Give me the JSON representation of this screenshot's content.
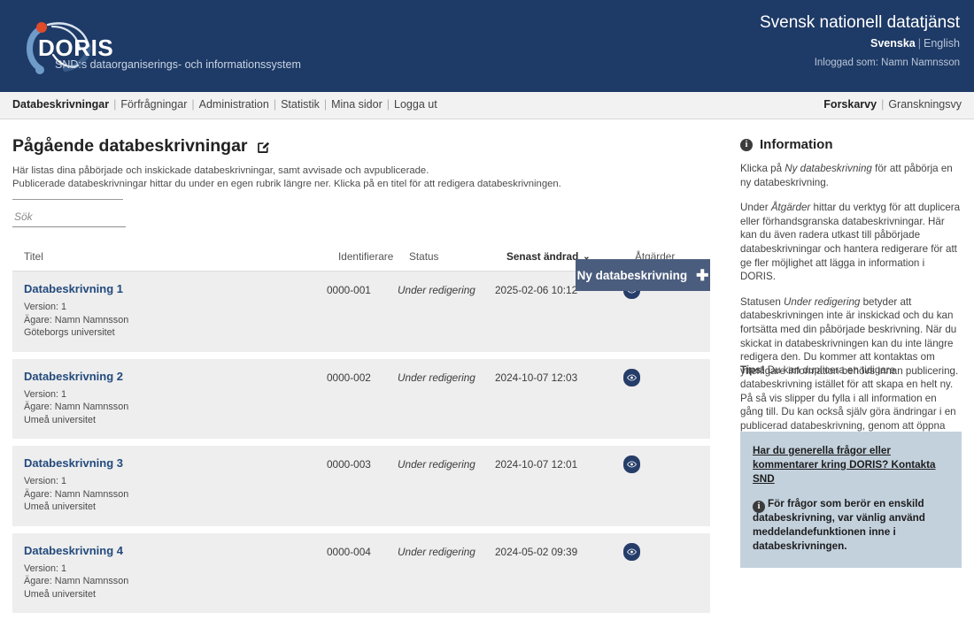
{
  "header": {
    "logo_word": "DORIS",
    "logo_subtitle": "SND:s dataorganiserings- och informationssystem",
    "brand_title": "Svensk nationell datatjänst",
    "lang_active": "Svenska",
    "lang_sep": "|",
    "lang_other": "English",
    "logged_in": "Inloggad som: Namn Namnsson"
  },
  "nav": {
    "left_items": [
      {
        "label": "Databeskrivningar",
        "current": true
      },
      {
        "label": "Förfrågningar",
        "current": false
      },
      {
        "label": "Administration",
        "current": false
      },
      {
        "label": "Statistik",
        "current": false
      },
      {
        "label": "Mina sidor",
        "current": false
      },
      {
        "label": "Logga ut",
        "current": false
      }
    ],
    "right_items": [
      {
        "label": "Forskarvy",
        "current": true
      },
      {
        "label": "Granskningsvy",
        "current": false
      }
    ],
    "separator": "|"
  },
  "main": {
    "page_title": "Pågående databeskrivningar",
    "intro_line1": "Här listas dina påbörjade och inskickade databeskrivningar, samt avvisade och avpublicerade.",
    "intro_line2": "Publicerade databeskrivningar hittar du under en egen rubrik längre ner. Klicka på en titel för att redigera databeskrivningen.",
    "search_placeholder": "Sök",
    "search_value": "",
    "new_button_label": "Ny databeskrivning",
    "new_button_icon": "plus-icon",
    "edit_icon": "edit-pencil-icon"
  },
  "table": {
    "columns": {
      "titel": "Titel",
      "identifierare": "Identifierare",
      "status": "Status",
      "senast_andrad": "Senast ändrad",
      "atgarder": "Åtgärder"
    },
    "sort_indicator": "⌄",
    "rows": [
      {
        "title": "Databeskrivning 1",
        "version": "Version: 1",
        "owner": "Ägare: Namn Namnsson",
        "organisation": "Göteborgs universitet",
        "identifier": "0000-001",
        "status": "Under redigering",
        "modified": "2025-02-06 10:12",
        "action_icon": "eye-icon"
      },
      {
        "title": "Databeskrivning 2",
        "version": "Version: 1",
        "owner": "Ägare: Namn Namnsson",
        "organisation": "Umeå universitet",
        "identifier": "0000-002",
        "status": "Under redigering",
        "modified": "2024-10-07 12:03",
        "action_icon": "eye-icon"
      },
      {
        "title": "Databeskrivning 3",
        "version": "Version: 1",
        "owner": "Ägare: Namn Namnsson",
        "organisation": "Umeå universitet",
        "identifier": "0000-003",
        "status": "Under redigering",
        "modified": "2024-10-07 12:01",
        "action_icon": "eye-icon"
      },
      {
        "title": "Databeskrivning 4",
        "version": "Version: 1",
        "owner": "Ägare: Namn Namnsson",
        "organisation": "Umeå universitet",
        "identifier": "0000-004",
        "status": "Under redigering",
        "modified": "2024-05-02 09:39",
        "action_icon": "eye-icon"
      }
    ]
  },
  "sidebar": {
    "info_icon": "info-circle-icon",
    "info_title": "Information",
    "para1_pre": "Klicka på ",
    "para1_em": "Ny databeskrivning",
    "para1_post": " för att påbörja en ny databeskrivning.",
    "para2_pre": "Under ",
    "para2_em": "Åtgärder",
    "para2_post": " hittar du verktyg för att duplicera eller förhandsgranska databeskrivningar. Här kan du även radera utkast till påbörjade databeskrivningar och hantera redigerare för att ge fler möjlighet att lägga in information i DORIS.",
    "para3_pre": "Statusen ",
    "para3_em": "Under redigering",
    "para3_post": " betyder att databeskrivningen inte är inskickad och du kan fortsätta med din påbörjade beskrivning. När du skickat in databeskrivningen kan du inte längre redigera den. Du kommer att kontaktas om ytterligare information behövs innan publicering.",
    "para4_strong": "Tips!",
    "para4_post": " Du kan duplicera en tidigare databeskrivning istället för att skapa en helt ny. På så vis slipper du fylla i all information en gång till. Du kan också själv göra ändringar i en publicerad databeskrivning, genom att öppna den på nytt och skapa en ny version.",
    "contact_link": "Har du generella frågor eller kommentarer kring DORIS? Kontakta SND",
    "contact_note": "För frågor som berör en enskild databeskrivning, var vänlig använd meddelandefunktionen inne i databeskrivningen.",
    "contact_icon": "info-circle-icon"
  },
  "colors": {
    "header_bg": "#1e3a66",
    "button_bg": "#4b5d7e",
    "link_blue": "#234a7d",
    "row_bg": "#eeeeee",
    "contact_box_bg": "#c3d1dd",
    "logo_dot": "#e04b2a"
  }
}
